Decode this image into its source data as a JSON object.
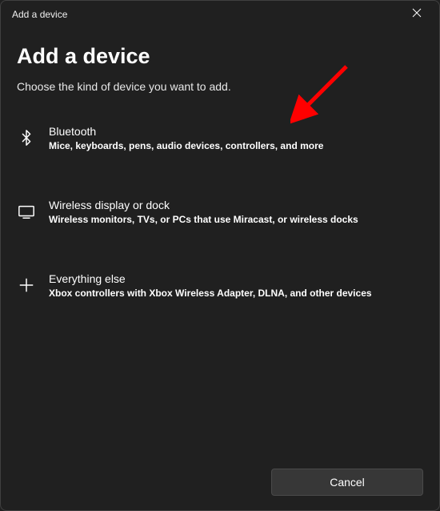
{
  "titlebar": {
    "title": "Add a device"
  },
  "heading": "Add a device",
  "subheading": "Choose the kind of device you want to add.",
  "options": [
    {
      "title": "Bluetooth",
      "desc": "Mice, keyboards, pens, audio devices, controllers, and more"
    },
    {
      "title": "Wireless display or dock",
      "desc": "Wireless monitors, TVs, or PCs that use Miracast, or wireless docks"
    },
    {
      "title": "Everything else",
      "desc": "Xbox controllers with Xbox Wireless Adapter, DLNA, and other devices"
    }
  ],
  "footer": {
    "cancel": "Cancel"
  },
  "annotation": {
    "arrow_color": "#ff0000"
  }
}
